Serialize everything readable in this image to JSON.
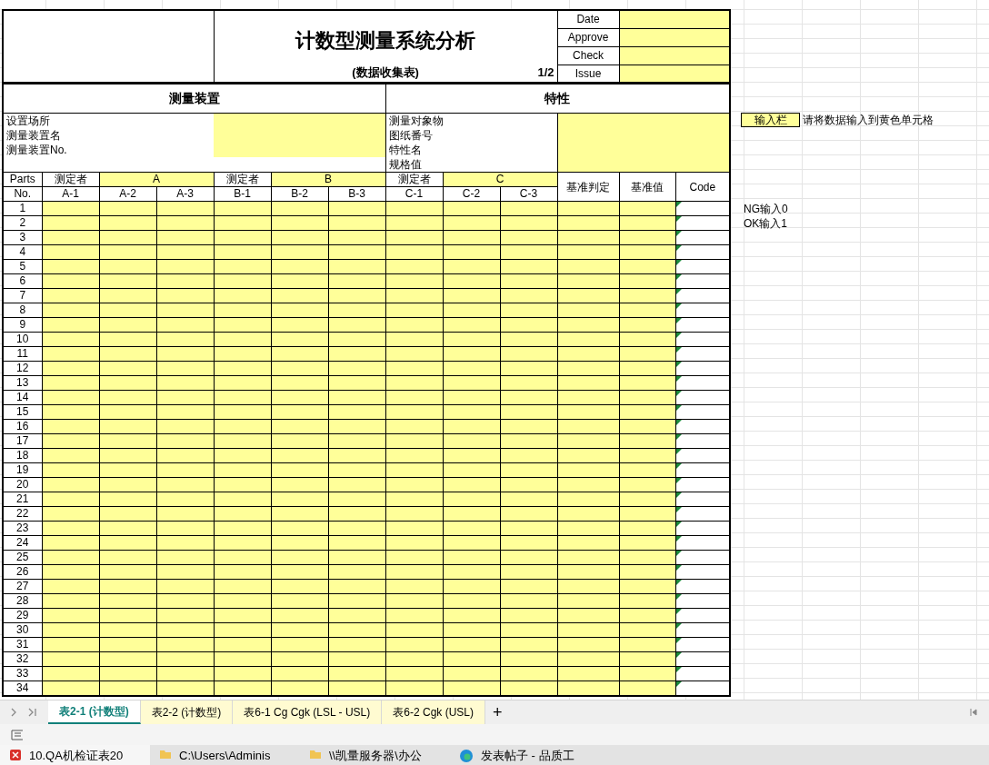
{
  "form": {
    "title": "计数型测量系统分析",
    "subtitle": "(数据收集表)",
    "page": "1/2",
    "approvals": [
      {
        "label": "Date"
      },
      {
        "label": "Approve"
      },
      {
        "label": "Check"
      },
      {
        "label": "Issue"
      }
    ],
    "sections": [
      "测量装置",
      "特性"
    ],
    "device_labels": [
      "设置场所",
      "测量装置名",
      "测量装置No."
    ],
    "feature_labels": [
      "测量对象物",
      "图纸番号",
      "特性名",
      "规格值"
    ],
    "header_top": [
      {
        "kind": "label",
        "text": "Parts"
      },
      {
        "kind": "label",
        "text": "测定者"
      },
      {
        "kind": "group",
        "text": "A"
      },
      {
        "kind": "label",
        "text": "测定者"
      },
      {
        "kind": "group",
        "text": "B"
      },
      {
        "kind": "label",
        "text": "测定者"
      },
      {
        "kind": "group",
        "text": "C"
      },
      {
        "kind": "tall",
        "text": "基准判定"
      },
      {
        "kind": "tall",
        "text": "基准值"
      },
      {
        "kind": "tall",
        "text": "Code"
      }
    ],
    "header_sub": [
      "No.",
      "A-1",
      "A-2",
      "A-3",
      "B-1",
      "B-2",
      "B-3",
      "C-1",
      "C-2",
      "C-3"
    ],
    "rows": [
      "1",
      "2",
      "3",
      "4",
      "5",
      "6",
      "7",
      "8",
      "9",
      "10",
      "11",
      "12",
      "13",
      "14",
      "15",
      "16",
      "17",
      "18",
      "19",
      "20",
      "21",
      "22",
      "23",
      "24",
      "25",
      "26",
      "27",
      "28",
      "29",
      "30",
      "31",
      "32",
      "33",
      "34"
    ]
  },
  "legend": {
    "swatch_label": "输入栏",
    "instruction": "请将数据输入到黄色单元格",
    "notes": [
      "NG输入0",
      "OK输入1"
    ]
  },
  "sheet_tabs": [
    {
      "label": "表2-1 (计数型)",
      "selected": true
    },
    {
      "label": "表2-2 (计数型)",
      "selected": false
    },
    {
      "label": "表6-1 Cg Cgk (LSL - USL)",
      "selected": false
    },
    {
      "label": "表6-2 Cgk (USL)",
      "selected": false
    }
  ],
  "add_tab": "+",
  "taskbar": [
    {
      "label": "10.QA机检证表20",
      "kind": "doc"
    },
    {
      "label": "C:\\Users\\Adminis",
      "kind": "folder"
    },
    {
      "label": "\\\\凯量服务器\\办公",
      "kind": "folder"
    },
    {
      "label": "发表帖子 - 品质工",
      "kind": "browser"
    }
  ]
}
